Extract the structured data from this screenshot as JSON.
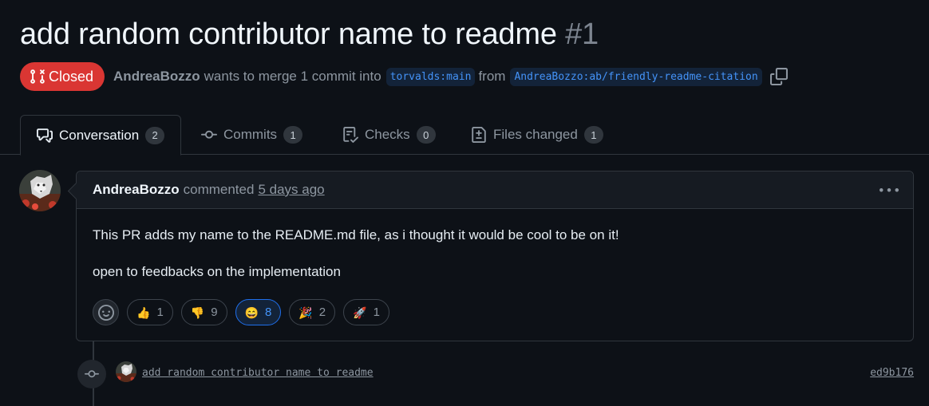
{
  "pr": {
    "title": "add random contributor name to readme",
    "number": "#1",
    "status": "Closed",
    "status_color": "#da3633",
    "author": "AndreaBozzo",
    "merge_text_1": "wants to merge 1 commit into",
    "base_branch": "torvalds:main",
    "merge_text_2": "from",
    "head_branch": "AndreaBozzo:ab/friendly-readme-citation",
    "copy_icon": "copy-icon"
  },
  "tabs": [
    {
      "label": "Conversation",
      "count": "2",
      "icon": "comment-discussion-icon",
      "active": true
    },
    {
      "label": "Commits",
      "count": "1",
      "icon": "git-commit-icon",
      "active": false
    },
    {
      "label": "Checks",
      "count": "0",
      "icon": "checklist-icon",
      "active": false
    },
    {
      "label": "Files changed",
      "count": "1",
      "icon": "file-diff-icon",
      "active": false
    }
  ],
  "comment": {
    "author": "AndreaBozzo",
    "action": "commented",
    "time": "5 days ago",
    "body": [
      "This PR adds my name to the README.md file, as i thought it would be cool to be on it!",
      "open to feedbacks on the implementation"
    ],
    "reactions": [
      {
        "emoji": "👍",
        "count": "1",
        "active": false
      },
      {
        "emoji": "👎",
        "count": "9",
        "active": false
      },
      {
        "emoji": "😄",
        "count": "8",
        "active": true
      },
      {
        "emoji": "🎉",
        "count": "2",
        "active": false
      },
      {
        "emoji": "🚀",
        "count": "1",
        "active": false
      }
    ]
  },
  "commit": {
    "message": "add random contributor name to readme",
    "sha": "ed9b176"
  },
  "colors": {
    "background": "#0d1117",
    "accent": "#4493f8",
    "border": "#30363d"
  }
}
